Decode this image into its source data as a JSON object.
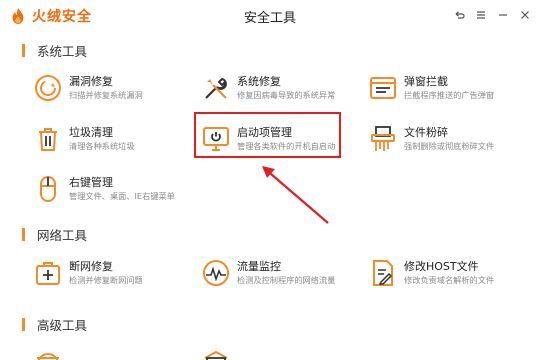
{
  "window": {
    "app_name": "火绒安全",
    "title": "安全工具",
    "controls": [
      "back-icon",
      "menu-icon",
      "minimize-icon",
      "close-icon"
    ]
  },
  "sections": [
    {
      "title": "系统工具",
      "tools": [
        {
          "name": "漏洞修复",
          "desc": "扫描并修复系统漏洞",
          "icon": "refresh-circle-icon"
        },
        {
          "name": "系统修复",
          "desc": "修复因病毒导致的系统异常",
          "icon": "wrench-screwdriver-icon"
        },
        {
          "name": "弹窗拦截",
          "desc": "拦截程序推送的广告弹窗",
          "icon": "popup-window-icon"
        },
        {
          "name": "垃圾清理",
          "desc": "清理各种系统垃圾",
          "icon": "trash-icon"
        },
        {
          "name": "启动项管理",
          "desc": "管理各类软件的开机自启动",
          "icon": "monitor-power-icon"
        },
        {
          "name": "文件粉碎",
          "desc": "强制删除或彻底粉碎文件",
          "icon": "shredder-icon"
        },
        {
          "name": "右键管理",
          "desc": "管理文件、桌面、IE右键菜单",
          "icon": "mouse-icon"
        }
      ]
    },
    {
      "title": "网络工具",
      "tools": [
        {
          "name": "断网修复",
          "desc": "检测并修复断网问题",
          "icon": "first-aid-icon"
        },
        {
          "name": "流量监控",
          "desc": "检测及控制程序的网络流量",
          "icon": "gauge-icon"
        },
        {
          "name": "修改HOST文件",
          "desc": "修改负责域名解析的文件",
          "icon": "edit-file-icon"
        }
      ]
    },
    {
      "title": "高级工具",
      "tools": []
    }
  ],
  "colors": {
    "accent": "#f28b28",
    "brand": "#f26b0f",
    "highlight": "#e02020"
  }
}
